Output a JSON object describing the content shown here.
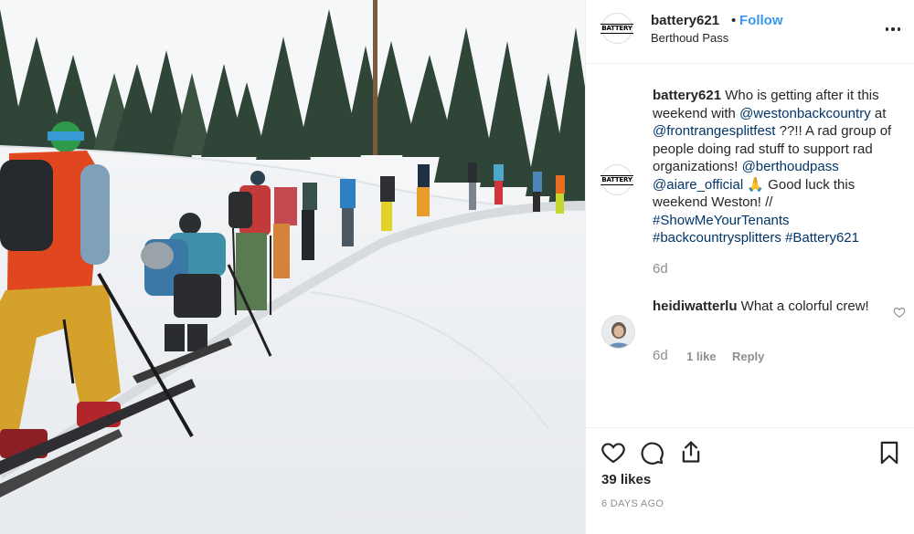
{
  "header": {
    "avatar_text": "BATTERY",
    "username": "battery621",
    "separator": "•",
    "follow_label": "Follow",
    "location": "Berthoud Pass",
    "more_icon": "more-options-icon"
  },
  "caption": {
    "avatar_text": "BATTERY",
    "username": "battery621",
    "segments": [
      {
        "type": "text",
        "value": " Who is getting after it this weekend with "
      },
      {
        "type": "link",
        "value": "@westonbackcountry"
      },
      {
        "type": "text",
        "value": " at "
      },
      {
        "type": "link",
        "value": "@frontrangesplitfest"
      },
      {
        "type": "text",
        "value": " ??!! A rad group of people doing rad stuff to support rad organizations! "
      },
      {
        "type": "link",
        "value": "@berthoudpass"
      },
      {
        "type": "text",
        "value": " "
      },
      {
        "type": "link",
        "value": "@aiare_official"
      },
      {
        "type": "text",
        "value": " 🙏  Good luck this weekend Weston! // "
      },
      {
        "type": "link",
        "value": "#ShowMeYourTenants"
      },
      {
        "type": "text",
        "value": " "
      },
      {
        "type": "link",
        "value": "#backcountrysplitters"
      },
      {
        "type": "text",
        "value": " "
      },
      {
        "type": "link",
        "value": "#Battery621"
      }
    ],
    "time": "6d"
  },
  "comment": {
    "username": "heidiwatterlu",
    "text": " What a colorful crew!",
    "time": "6d",
    "likes": "1 like",
    "reply_label": "Reply"
  },
  "actions": {
    "icons": [
      "heart-icon",
      "comment-icon",
      "share-icon",
      "bookmark-icon"
    ],
    "likes": "39 likes",
    "date": "6 DAYS AGO"
  },
  "colors": {
    "link": "#003569",
    "follow": "#3897f0",
    "muted": "#8e8e8e",
    "text": "#262626"
  }
}
